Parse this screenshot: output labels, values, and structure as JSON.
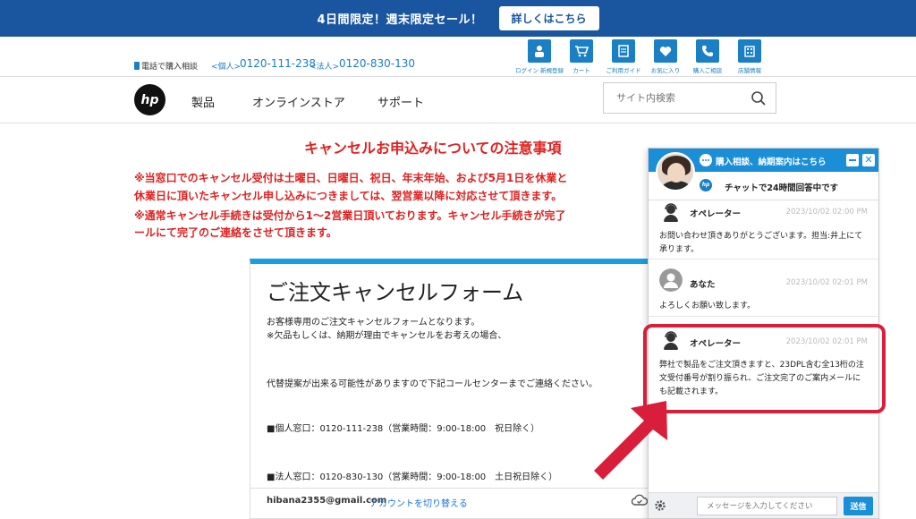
{
  "promo": {
    "text": "4日間限定！週末限定セール！",
    "button": "詳しくはこちら"
  },
  "contact": {
    "phone_label": "電話で購入相談",
    "personal_label": "<個人>",
    "personal_number": "0120-111-238",
    "corporate_label": "<法人>",
    "corporate_number": "0120-830-130"
  },
  "utility_nav": [
    {
      "label": "ログイン 新規登録",
      "icon": "person-icon"
    },
    {
      "label": "カート",
      "icon": "cart-icon"
    },
    {
      "label": "ご利用ガイド",
      "icon": "guide-icon"
    },
    {
      "label": "お気に入り",
      "icon": "heart-icon"
    },
    {
      "label": "購入ご相談",
      "icon": "phone-icon"
    },
    {
      "label": "店舗情報",
      "icon": "store-icon"
    }
  ],
  "nav": {
    "logo": "hp",
    "items": [
      "製品",
      "オンラインストア",
      "サポート"
    ],
    "search_placeholder": "サイト内検索"
  },
  "notice": {
    "title": "キャンセルお申込みについての注意事項",
    "lines": [
      "※当窓口でのキャンセル受付は土曜日、日曜日、祝日、年末年始、および5月1日を休業と",
      "休業日に頂いたキャンセル申し込みにつきましては、翌営業以降に対応させて頂きます。",
      "※通常キャンセル手続きは受付から1〜2営業日頂いております。キャンセル手続きが完了",
      "ールにて完了のご連絡をさせて頂きます。"
    ]
  },
  "form": {
    "title": "ご注文キャンセルフォーム",
    "lines": [
      "お客様専用のご注文キャンセルフォームとなります。",
      "※欠品もしくは、納期が理由でキャンセルをお考えの場合、",
      "代替提案が出来る可能性がありますので下記コールセンターまでご連絡ください。",
      "■個人窓口：0120-111-238（営業時間：9:00-18:00　祝日除く）",
      "■法人窓口：0120-830-130（営業時間：9:00-18:00　土日祝日除く）"
    ],
    "email": "hibana2355@gmail.com",
    "switch_account": "アカウントを切り替える"
  },
  "chat": {
    "header_title": "購入相談、納期案内はこちら",
    "sub_title": "チャットで24時間回答中です",
    "messages": [
      {
        "sender": "オペレーター",
        "time": "2023/10/02 02:00 PM",
        "body": "お問い合わせ頂きありがとうございます。担当:井上にて承ります。"
      },
      {
        "sender": "あなた",
        "time": "2023/10/02 02:01 PM",
        "body": "よろしくお願い致します。"
      },
      {
        "sender": "オペレーター",
        "time": "2023/10/02 02:01 PM",
        "body": "弊社で製品をご注文頂きますと、23DPL含む全13桁の注文受付番号が割り振られ、ご注文完了のご案内メールにも記載されます。"
      }
    ],
    "input_placeholder": "メッセージを入力してください",
    "send_label": "送信"
  },
  "colors": {
    "brand_blue": "#1a56a0",
    "accent_blue": "#1a8fd8",
    "alert_red": "#e02020",
    "highlight_red": "#d91e3b"
  }
}
